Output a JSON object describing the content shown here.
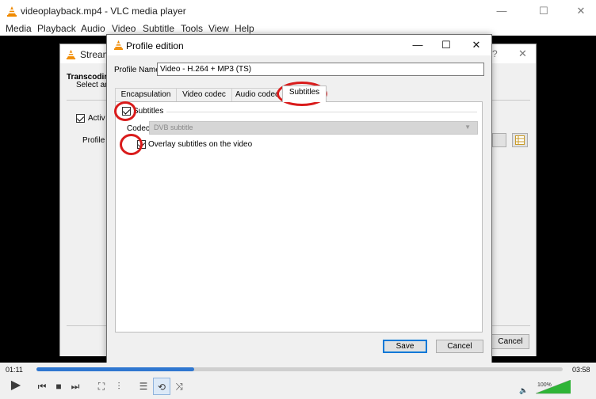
{
  "vlc": {
    "title": "videoplayback.mp4 - VLC media player",
    "menu": [
      "Media",
      "Playback",
      "Audio",
      "Video",
      "Subtitle",
      "Tools",
      "View",
      "Help"
    ],
    "window_buttons": {
      "minimize": "—",
      "maximize": "☐",
      "close": "✕"
    }
  },
  "stream_dialog": {
    "title": "Stream",
    "heading": "Transcodir",
    "subheading": "Select an",
    "activate_label": "Activ",
    "activate_checked": true,
    "profile_label": "Profile",
    "help": "?",
    "close": "✕",
    "cancel_label": "Cancel"
  },
  "profile_dialog": {
    "title": "Profile edition",
    "window_buttons": {
      "minimize": "—",
      "maximize": "☐",
      "close": "✕"
    },
    "profile_name_label": "Profile Name",
    "profile_name_value": "Video - H.264 + MP3 (TS)",
    "tabs": [
      "Encapsulation",
      "Video codec",
      "Audio codec",
      "Subtitles"
    ],
    "active_tab": "Subtitles",
    "subtitles": {
      "enable_label": "Subtitles",
      "enable_checked": true,
      "codec_label": "Codec",
      "codec_value": "DVB subtitle",
      "overlay_label": "Overlay subtitles on the video",
      "overlay_checked": true
    },
    "save_label": "Save",
    "cancel_label": "Cancel"
  },
  "player": {
    "elapsed": "01:11",
    "total": "03:58",
    "progress": 0.3,
    "volume": "100%",
    "volume_level": 1.0
  },
  "colors": {
    "annotation": "#d91b1b",
    "seek_fill": "#2f77d0",
    "vlc_orange": "#f08a00"
  }
}
